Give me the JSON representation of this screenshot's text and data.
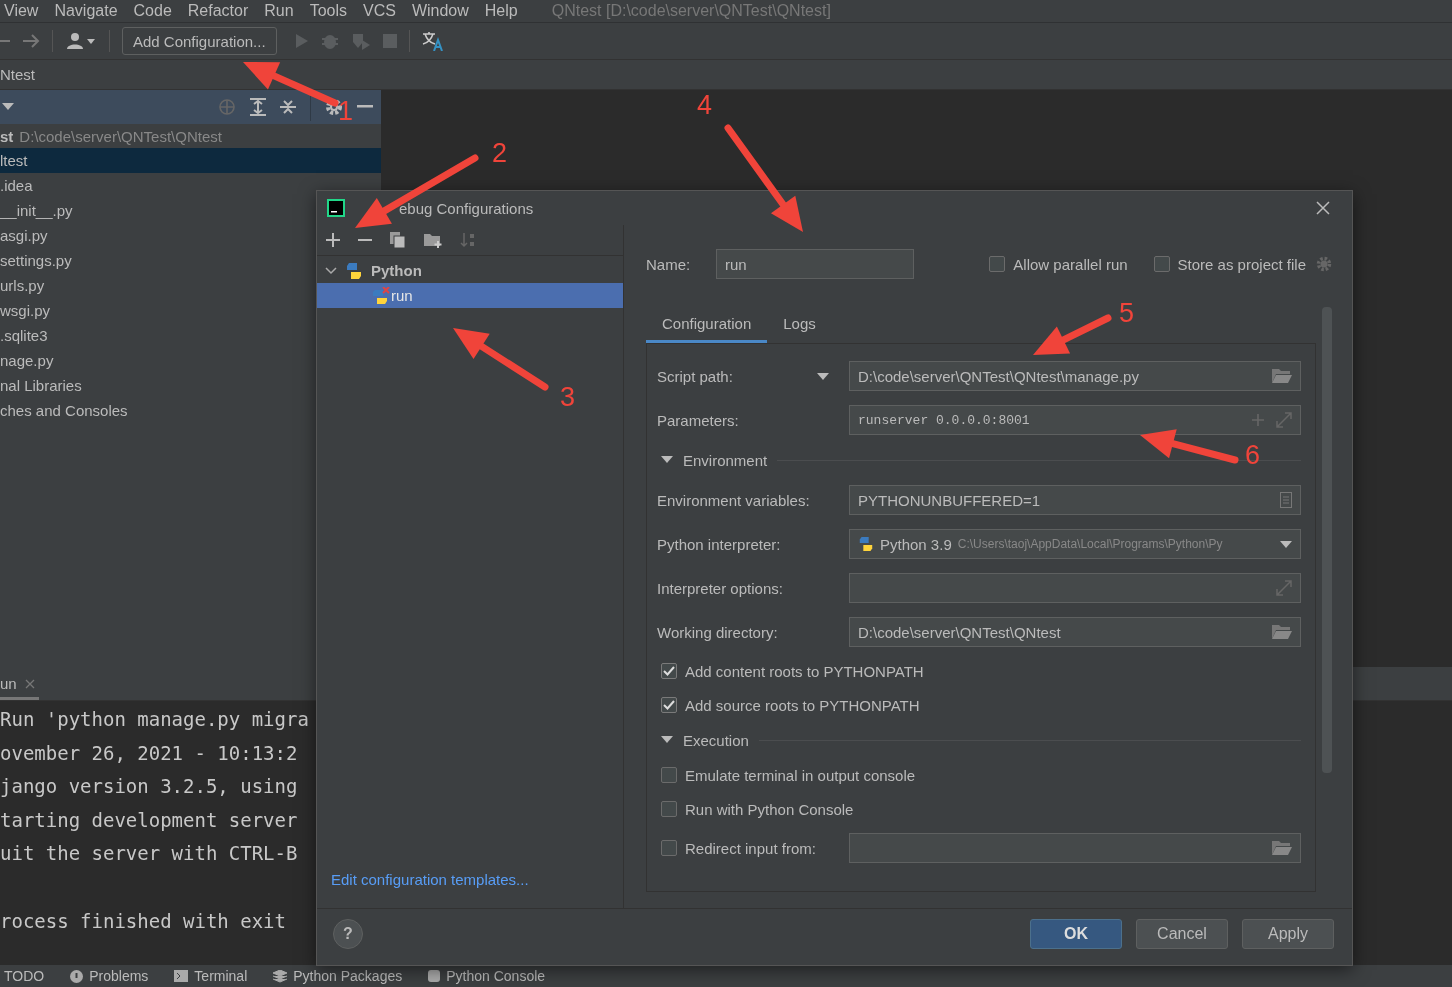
{
  "menu": {
    "items": [
      "View",
      "Navigate",
      "Code",
      "Refactor",
      "Run",
      "Tools",
      "VCS",
      "Window",
      "Help"
    ],
    "title": "QNtest [D:\\code\\server\\QNTest\\QNtest]"
  },
  "toolbar": {
    "config_button": "Add Configuration..."
  },
  "breadcrumb": "Ntest",
  "project": {
    "root_name": "st",
    "root_path": "D:\\code\\server\\QNTest\\QNtest",
    "items": [
      {
        "label": "ltest",
        "selected": true
      },
      {
        "label": ".idea",
        "selected": false
      },
      {
        "label": "__init__.py",
        "selected": false
      },
      {
        "label": "asgi.py",
        "selected": false
      },
      {
        "label": "settings.py",
        "selected": false
      },
      {
        "label": "urls.py",
        "selected": false
      },
      {
        "label": "wsgi.py",
        "selected": false
      },
      {
        "label": ".sqlite3",
        "selected": false
      },
      {
        "label": "nage.py",
        "selected": false
      },
      {
        "label": "nal Libraries",
        "selected": false
      },
      {
        "label": "ches and Consoles",
        "selected": false
      }
    ]
  },
  "run_panel": {
    "tab": "un",
    "lines": [
      "Run 'python manage.py migra",
      "ovember 26, 2021 - 10:13:2",
      "jango version 3.2.5, using",
      "tarting development server",
      "uit the server with CTRL-B"
    ],
    "exit_line": "rocess finished with exit"
  },
  "status_bar": {
    "items": [
      {
        "label": "TODO",
        "kind": "todo"
      },
      {
        "label": "Problems",
        "kind": "problems"
      },
      {
        "label": "Terminal",
        "kind": "terminal"
      },
      {
        "label": "Python Packages",
        "kind": "packages"
      },
      {
        "label": "Python Console",
        "kind": "console"
      }
    ]
  },
  "dialog": {
    "title": "ebug Configurations",
    "help_label": "?",
    "tree": {
      "group": "Python",
      "expanded": true,
      "items": [
        {
          "label": "run",
          "selected": true
        }
      ]
    },
    "templates_link": "Edit configuration templates...",
    "name_label": "Name:",
    "name": "run",
    "options": [
      {
        "label": "Allow parallel run",
        "checked": false
      },
      {
        "label": "Store as project file",
        "checked": false
      }
    ],
    "tabs": [
      {
        "label": "Configuration",
        "selected": true
      },
      {
        "label": "Logs",
        "selected": false
      }
    ],
    "rows": [
      {
        "kind": "path-field",
        "label": "Script path:",
        "dropdown": true,
        "value": "D:\\code\\server\\QNTest\\QNtest\\manage.py"
      },
      {
        "kind": "params-field",
        "label": "Parameters:",
        "value": "runserver 0.0.0.0:8001"
      },
      {
        "kind": "section",
        "label": "Environment",
        "expanded": true
      },
      {
        "kind": "env-field",
        "label": "Environment variables:",
        "value": "PYTHONUNBUFFERED=1"
      },
      {
        "kind": "interpreter",
        "label": "Python interpreter:",
        "value": "Python 3.9",
        "detail": "C:\\Users\\taoj\\AppData\\Local\\Programs\\Python\\Py"
      },
      {
        "kind": "expand-field",
        "label": "Interpreter options:"
      },
      {
        "kind": "path-field",
        "label": "Working directory:",
        "value": "D:\\code\\server\\QNTest\\QNtest"
      },
      {
        "kind": "checkbox",
        "label": "Add content roots to PYTHONPATH",
        "checked": true
      },
      {
        "kind": "checkbox",
        "label": "Add source roots to PYTHONPATH",
        "checked": true
      },
      {
        "kind": "section",
        "label": "Execution",
        "expanded": true
      },
      {
        "kind": "checkbox",
        "label": "Emulate terminal in output console",
        "checked": false
      },
      {
        "kind": "checkbox",
        "label": "Run with Python Console",
        "checked": false
      },
      {
        "kind": "checkbox-path-field",
        "label": "Redirect input from:",
        "checked": false
      }
    ],
    "buttons": [
      {
        "label": "OK",
        "kind": "default"
      },
      {
        "label": "Cancel",
        "kind": "normal"
      },
      {
        "label": "Apply",
        "kind": "normal"
      }
    ]
  },
  "annotations": [
    {
      "label": "1"
    },
    {
      "label": "2"
    },
    {
      "label": "3"
    },
    {
      "label": "4"
    },
    {
      "label": "5"
    },
    {
      "label": "6"
    }
  ]
}
